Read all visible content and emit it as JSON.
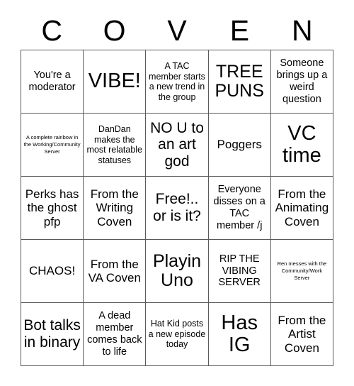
{
  "card": {
    "title_letters": [
      "C",
      "O",
      "V",
      "E",
      "N"
    ],
    "rows": [
      [
        {
          "text": "You're a moderator",
          "size": "sm"
        },
        {
          "text": "VIBE!",
          "size": "xxl"
        },
        {
          "text": "A TAC member starts a new trend in the group",
          "size": "xs"
        },
        {
          "text": "TREE PUNS",
          "size": "xl"
        },
        {
          "text": "Someone brings up a weird question",
          "size": "sm"
        }
      ],
      [
        {
          "text": "A complete rainbow in the Working/Community Server",
          "size": "xxs"
        },
        {
          "text": "DanDan makes the most relatable statuses",
          "size": "xs"
        },
        {
          "text": "NO U to an art god",
          "size": "lg"
        },
        {
          "text": "Poggers",
          "size": "md"
        },
        {
          "text": "VC time",
          "size": "xxl"
        }
      ],
      [
        {
          "text": "Perks has the ghost pfp",
          "size": "md"
        },
        {
          "text": "From the Writing Coven",
          "size": "md"
        },
        {
          "text": "Free!.. or is it?",
          "size": "lg"
        },
        {
          "text": "Everyone disses on a TAC member /j",
          "size": "sm"
        },
        {
          "text": "From the Animating Coven",
          "size": "md"
        }
      ],
      [
        {
          "text": "CHAOS!",
          "size": "md"
        },
        {
          "text": "From the VA Coven",
          "size": "md"
        },
        {
          "text": "Playin Uno",
          "size": "xl"
        },
        {
          "text": "RIP THE VIBING SERVER",
          "size": "sm"
        },
        {
          "text": "Ren messes with the Community/Work Server",
          "size": "xxs"
        }
      ],
      [
        {
          "text": "Bot talks in binary",
          "size": "lg"
        },
        {
          "text": "A dead member comes back to life",
          "size": "sm"
        },
        {
          "text": "Hat Kid posts a new episode today",
          "size": "xs"
        },
        {
          "text": "Has IG",
          "size": "xxl"
        },
        {
          "text": "From the Artist Coven",
          "size": "md"
        }
      ]
    ]
  },
  "colors": {
    "background": "#ffffff",
    "text": "#000000",
    "grid_line": "#5a5a5a"
  }
}
